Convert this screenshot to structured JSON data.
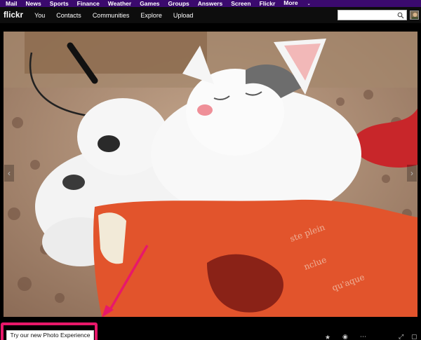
{
  "yahoo_bar": {
    "items": [
      "Mail",
      "News",
      "Sports",
      "Finance",
      "Weather",
      "Games",
      "Groups",
      "Answers",
      "Screen",
      "Flickr",
      "More"
    ]
  },
  "flickr_nav": {
    "logo": "flickr",
    "links": [
      "You",
      "Contacts",
      "Communities",
      "Explore",
      "Upload"
    ],
    "search_value": ""
  },
  "photo": {
    "icon_names": [
      "chevron-left-icon",
      "chevron-right-icon"
    ]
  },
  "bottom": {
    "try_button": "Try our new Photo Experience",
    "icon_names": [
      "star-icon",
      "comment-icon",
      "more-icon",
      "expand-icon",
      "fullscreen-icon"
    ]
  },
  "colors": {
    "yahoo_purple": "#3b0a6e",
    "highlight_pink": "#e8186a",
    "nav_bg": "#0d0d0d"
  }
}
